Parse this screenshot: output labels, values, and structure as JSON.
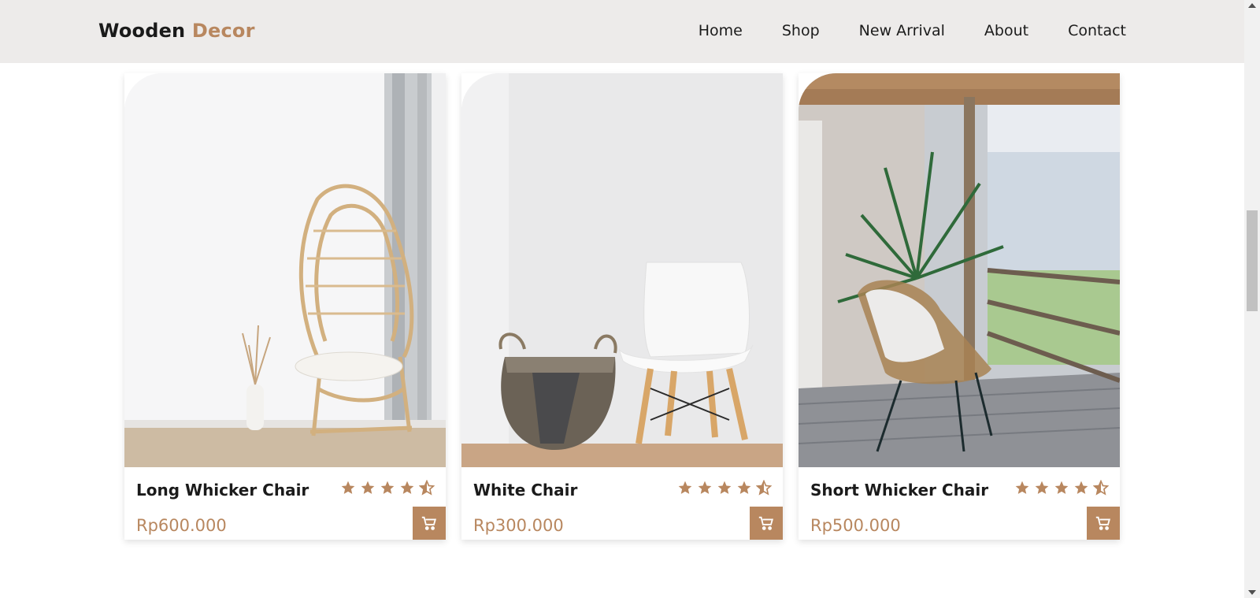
{
  "header": {
    "logo_main": "Wooden",
    "logo_accent": "Decor",
    "nav": [
      "Home",
      "Shop",
      "New Arrival",
      "About",
      "Contact"
    ]
  },
  "colors": {
    "accent": "#b8875f",
    "header_bg": "#edebea",
    "text": "#1b1b1b"
  },
  "products": [
    {
      "name": "Long Whicker Chair",
      "price": "Rp600.000",
      "rating": 4.5,
      "image": "rattan-egg-chair"
    },
    {
      "name": "White Chair",
      "price": "Rp300.000",
      "rating": 4.5,
      "image": "white-chair-and-basket"
    },
    {
      "name": "Short Whicker Chair",
      "price": "Rp500.000",
      "rating": 4.5,
      "image": "porch-chair-with-plants"
    }
  ],
  "icons": {
    "cart": "cart-icon",
    "star": "star-icon",
    "half_star": "half-star-icon"
  }
}
